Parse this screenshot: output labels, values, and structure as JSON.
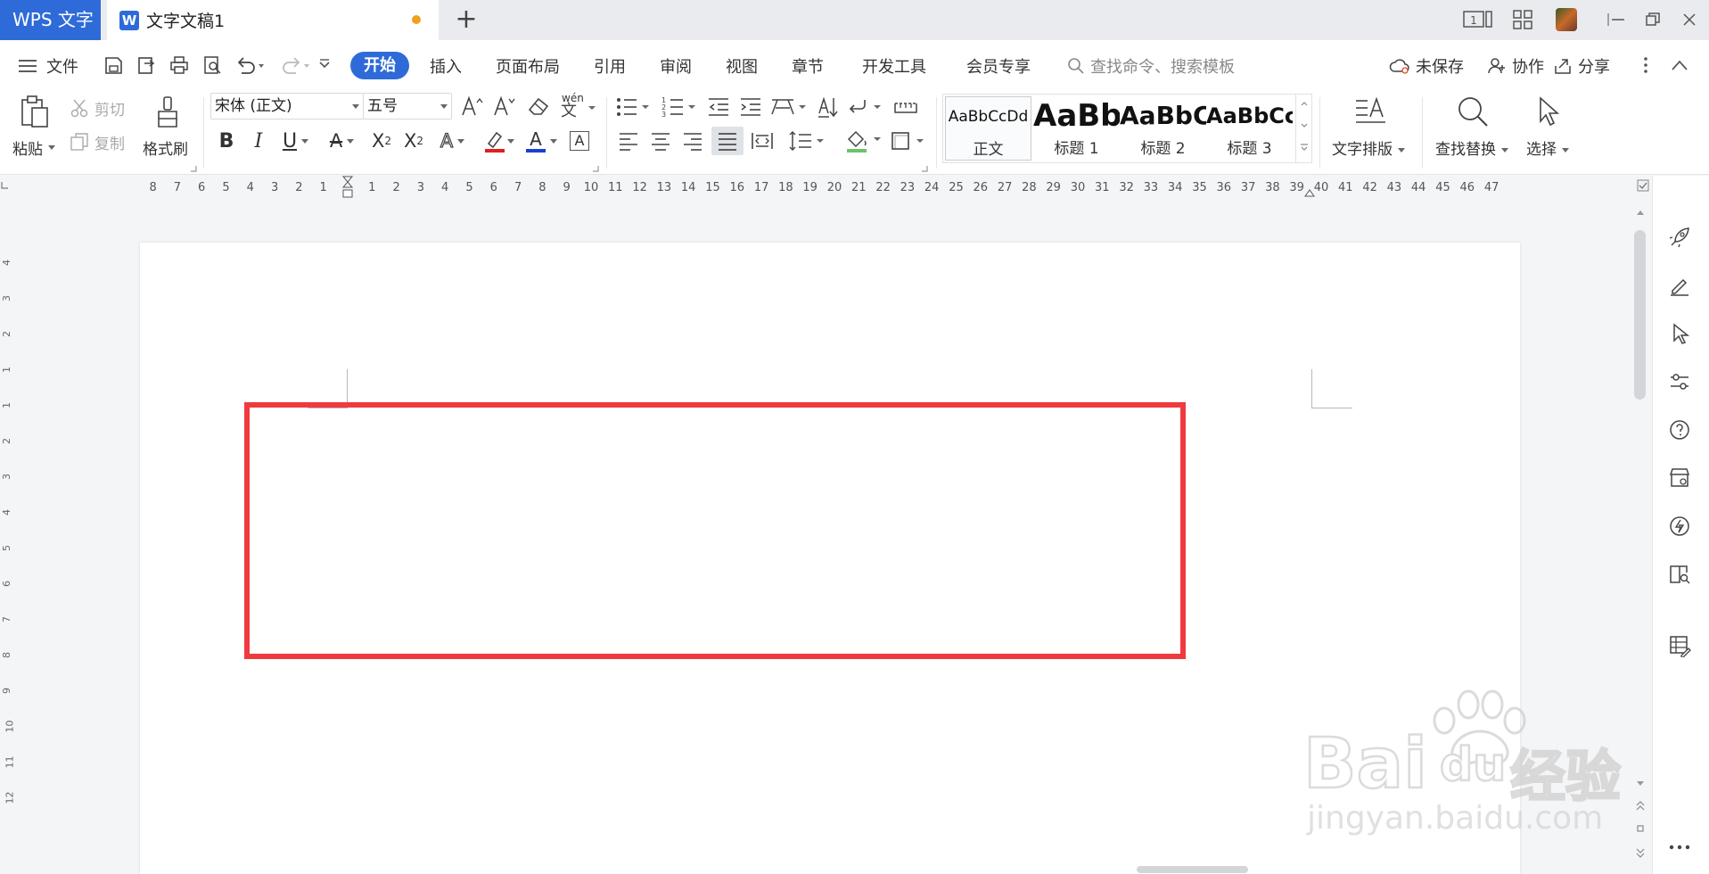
{
  "titlebar": {
    "app_tab": "WPS 文字",
    "doc_tab": "文字文稿1",
    "doc_icon_letter": "W",
    "page_indicator": "1"
  },
  "menu": {
    "file": "文件",
    "tabs": [
      "开始",
      "插入",
      "页面布局",
      "引用",
      "审阅",
      "视图",
      "章节",
      "开发工具",
      "会员专享"
    ],
    "search_placeholder": "查找命令、搜索模板",
    "unsaved": "未保存",
    "collaborate": "协作",
    "share": "分享"
  },
  "ribbon": {
    "paste": "粘贴",
    "cut": "剪切",
    "copy": "复制",
    "format_painter": "格式刷",
    "font_name": "宋体 (正文)",
    "font_size": "五号",
    "phonetic": "wén",
    "bold": "B",
    "italic": "I",
    "underline": "U",
    "strikethrough": "A",
    "superscript_base": "X",
    "superscript_mark": "2",
    "subscript_base": "X",
    "subscript_mark": "2",
    "text_effect": "A",
    "font_color": "A",
    "char_border": "A",
    "styles": [
      {
        "preview": "AaBbCcDd",
        "name": "正文"
      },
      {
        "preview": "AaBb",
        "name": "标题 1"
      },
      {
        "preview": "AaBbC",
        "name": "标题 2"
      },
      {
        "preview": "AaBbCc",
        "name": "标题 3"
      }
    ],
    "text_layout": "文字排版",
    "find_replace": "查找替换",
    "select": "选择"
  },
  "ruler": {
    "left_numbers": [
      "8",
      "7",
      "6",
      "5",
      "4",
      "3",
      "2",
      "1"
    ],
    "right_numbers": [
      "1",
      "2",
      "3",
      "4",
      "5",
      "6",
      "7",
      "8",
      "9",
      "10",
      "11",
      "12",
      "13",
      "14",
      "15",
      "16",
      "17",
      "18",
      "19",
      "20",
      "21",
      "22",
      "23",
      "24",
      "25",
      "26",
      "27",
      "28",
      "29",
      "30",
      "31",
      "32",
      "33",
      "34",
      "35",
      "36",
      "37",
      "38",
      "39",
      "40",
      "41",
      "42",
      "43",
      "44",
      "45",
      "46",
      "47"
    ],
    "vertical_numbers": [
      "4",
      "3",
      "2",
      "1",
      "1",
      "2",
      "3",
      "4",
      "5",
      "6",
      "7",
      "8",
      "9",
      "10",
      "11",
      "12"
    ]
  },
  "watermark": {
    "brand_left": "Bai",
    "brand_right": "du",
    "product": "经验",
    "url": "jingyan.baidu.com"
  },
  "colors": {
    "accent": "#2e6bd8",
    "highlight_box": "#ef3a3f",
    "unsaved_dot": "#f0a020",
    "font_color_bar": "#1e3fd1",
    "highlighter_bar": "#e02020",
    "shading_bar": "#6cc36c"
  }
}
